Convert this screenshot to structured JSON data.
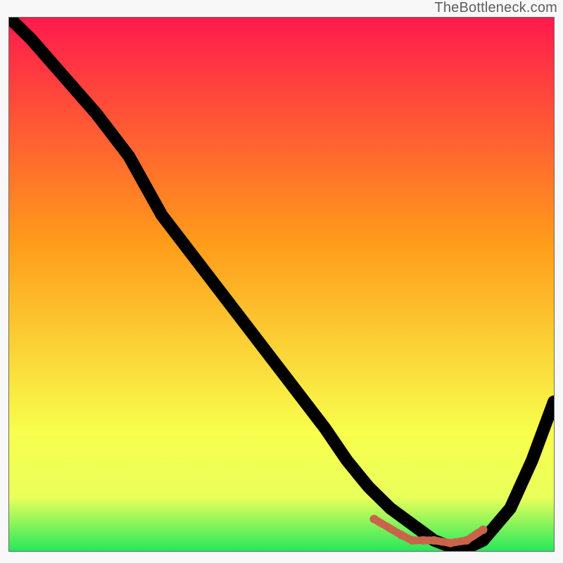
{
  "attribution": "TheBottleneck.com",
  "chart_data": {
    "type": "line",
    "title": "",
    "xlabel": "",
    "ylabel": "",
    "xlim": [
      0,
      100
    ],
    "ylim": [
      0,
      100
    ],
    "gradient": {
      "top_color": "#ff1a4d",
      "mid_top_color": "#ff9b1a",
      "mid_bottom_color": "#f8ff4d",
      "bottom_color": "#25e85b"
    },
    "series": [
      {
        "name": "bottleneck-curve",
        "x": [
          0,
          4,
          10,
          16,
          22,
          28,
          34,
          40,
          46,
          52,
          58,
          62,
          66,
          70,
          74,
          78,
          83,
          87,
          92,
          96,
          100
        ],
        "y": [
          100,
          96,
          89,
          82,
          74,
          63,
          55,
          47,
          39,
          31,
          23,
          17,
          12,
          8,
          5,
          2,
          0,
          2,
          8,
          17,
          28
        ]
      }
    ],
    "highlight": {
      "name": "optimal-region",
      "points_x": [
        67,
        72,
        74,
        76,
        78,
        81,
        84,
        87
      ],
      "points_y": [
        6,
        3,
        2,
        2,
        2,
        1.5,
        2,
        4
      ]
    }
  }
}
